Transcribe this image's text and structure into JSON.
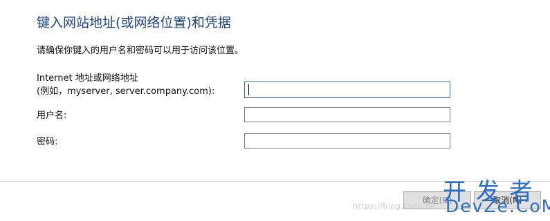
{
  "dialog": {
    "title": "键入网站地址(或网络位置)和凭据",
    "instruction": "请确保你键入的用户名和密码可以用于访问该位置。"
  },
  "form": {
    "address_label_line1": "Internet 地址或网络地址",
    "address_label_line2": "(例如，myserver, server.company.com):",
    "address_value": "",
    "username_label": "用户名:",
    "username_value": "",
    "password_label": "密码:",
    "password_value": ""
  },
  "buttons": {
    "ok_label": "确定(O)",
    "cancel_label": "取消(N)"
  },
  "watermark": {
    "url_text": "https://blog.csdn.ne",
    "brand_cn": "开发者",
    "brand_en": "DevZe.CoM"
  },
  "colors": {
    "title": "#1e3f8a",
    "focus_border": "#3c6fb8",
    "watermark_brand": "#2a6ec8"
  }
}
